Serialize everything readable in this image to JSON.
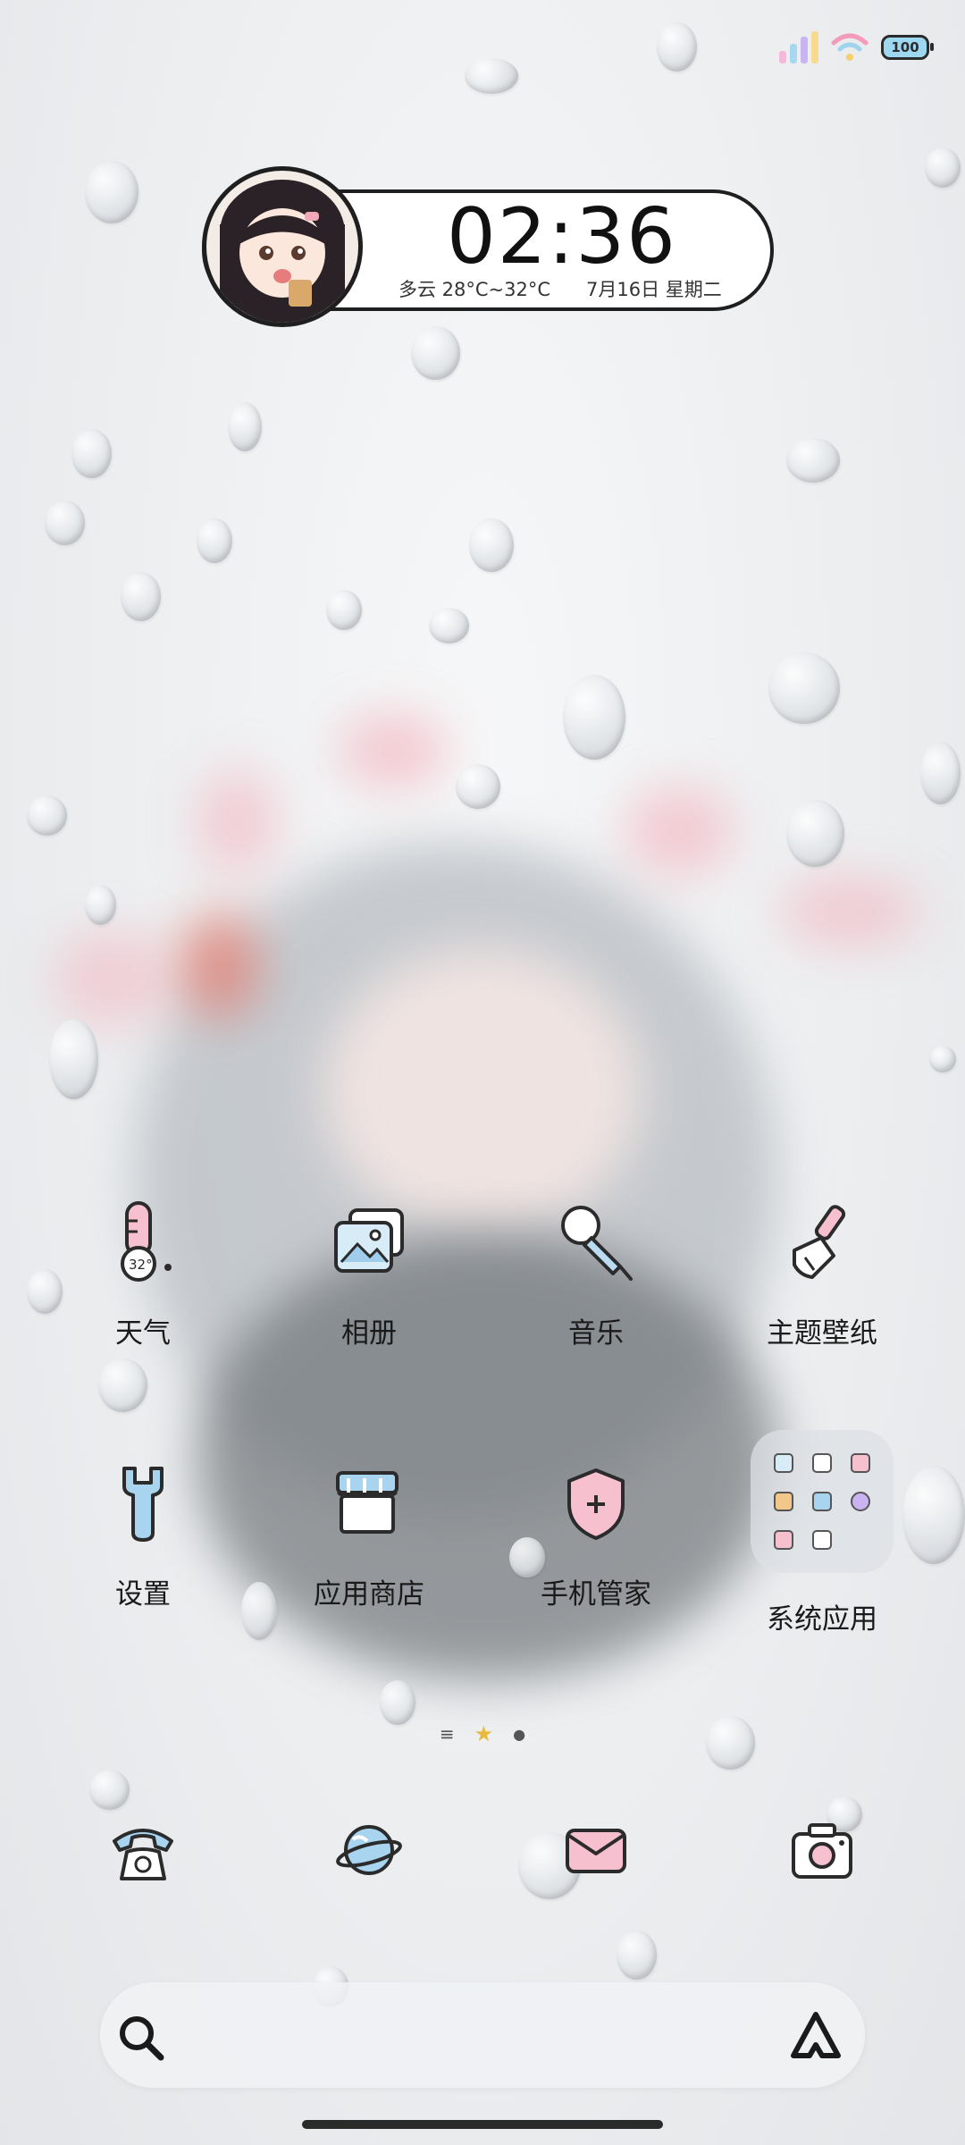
{
  "status_bar": {
    "battery_level": "100",
    "signal_colors": [
      "#f5b8d8",
      "#a8d8f0",
      "#c9b3f0",
      "#f7d98f"
    ]
  },
  "clock_widget": {
    "time": "02:36",
    "weather": "多云 28°C~32°C",
    "date": "7月16日 星期二"
  },
  "apps": [
    {
      "label": "天气",
      "icon": "thermometer-icon",
      "badge": "32°"
    },
    {
      "label": "相册",
      "icon": "photos-icon"
    },
    {
      "label": "音乐",
      "icon": "microphone-icon"
    },
    {
      "label": "主题壁纸",
      "icon": "paintbrush-icon"
    },
    {
      "label": "设置",
      "icon": "wrench-icon"
    },
    {
      "label": "应用商店",
      "icon": "store-icon"
    },
    {
      "label": "手机管家",
      "icon": "shield-icon"
    },
    {
      "label": "系统应用",
      "icon": "folder-icon"
    }
  ],
  "dock": [
    {
      "icon": "phone-icon"
    },
    {
      "icon": "browser-planet-icon"
    },
    {
      "icon": "messages-icon"
    },
    {
      "icon": "camera-icon"
    }
  ],
  "search": {
    "placeholder": ""
  },
  "colors": {
    "accent_pink": "#f2b7c8",
    "accent_blue": "#a9d4f0",
    "outline": "#2b2b2b"
  }
}
